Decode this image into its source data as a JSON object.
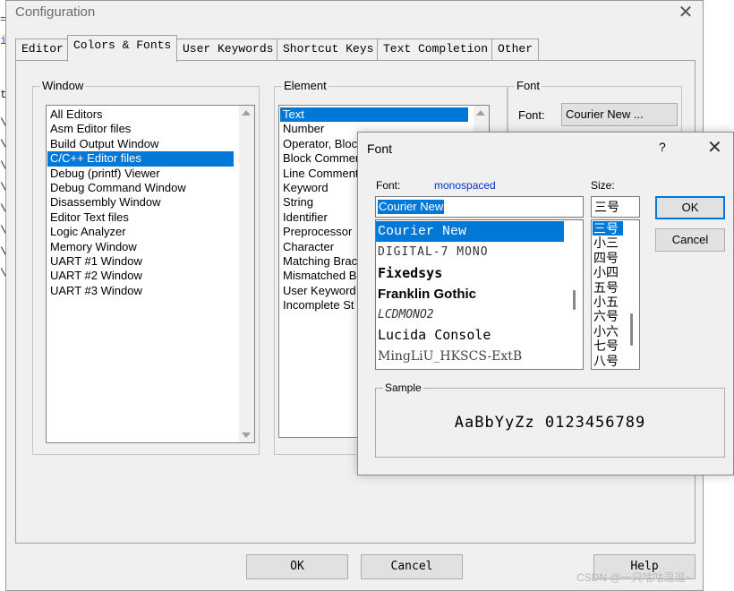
{
  "config": {
    "title": "Configuration",
    "close_glyph": "✕",
    "tabs": [
      "Editor",
      "Colors & Fonts",
      "User Keywords",
      "Shortcut Keys",
      "Text Completion",
      "Other"
    ],
    "window_group": {
      "label": "Window",
      "items": [
        "All Editors",
        "Asm Editor files",
        "Build Output Window",
        "C/C++ Editor files",
        "Debug (printf) Viewer",
        "Debug Command Window",
        "Disassembly Window",
        "Editor Text files",
        "Logic Analyzer",
        "Memory Window",
        "UART #1 Window",
        "UART #2 Window",
        "UART #3 Window"
      ],
      "selected_index": 3
    },
    "element_group": {
      "label": "Element",
      "items": [
        "Text",
        "Number",
        "Operator, Bloc",
        "Block Commer",
        "Line Comment",
        "Keyword",
        "String",
        "Identifier",
        "Preprocessor",
        "Character",
        "Matching Brac",
        "Mismatched B",
        "User Keyword",
        "Incomplete St"
      ],
      "selected_index": 0
    },
    "font_group": {
      "label": "Font",
      "font_label": "Font:",
      "font_button": "Courier New ..."
    },
    "buttons": {
      "ok": "OK",
      "cancel": "Cancel",
      "help": "Help"
    }
  },
  "font_dialog": {
    "title": "Font",
    "help": "?",
    "close": "✕",
    "font_label": "Font:",
    "font_hint": "monospaced",
    "font_value": "Courier New",
    "font_list": [
      "Courier New",
      "DIGITAL-7 MONO",
      "Fixedsys",
      "Franklin Gothic",
      "LCDMONO2",
      "Lucida Console",
      "MingLiU_HKSCS-ExtB"
    ],
    "selected_font_index": 0,
    "size_label": "Size:",
    "size_value": "三号",
    "size_list": [
      "三号",
      "小三",
      "四号",
      "小四",
      "五号",
      "小五",
      "六号",
      "小六",
      "七号",
      "八号"
    ],
    "selected_size_index": 0,
    "ok": "OK",
    "cancel": "Cancel",
    "sample_label": "Sample",
    "sample_text": "AaBbYyZz 0123456789",
    "hint_color": "#0033cc"
  },
  "background_editor": {
    "glyphs": [
      "=",
      "i",
      "t",
      "\\",
      "\\",
      "\\",
      "\\",
      "\\",
      "\\",
      "\\",
      "\\"
    ]
  },
  "watermark": "CSDN @一只咕咕逗逗~"
}
